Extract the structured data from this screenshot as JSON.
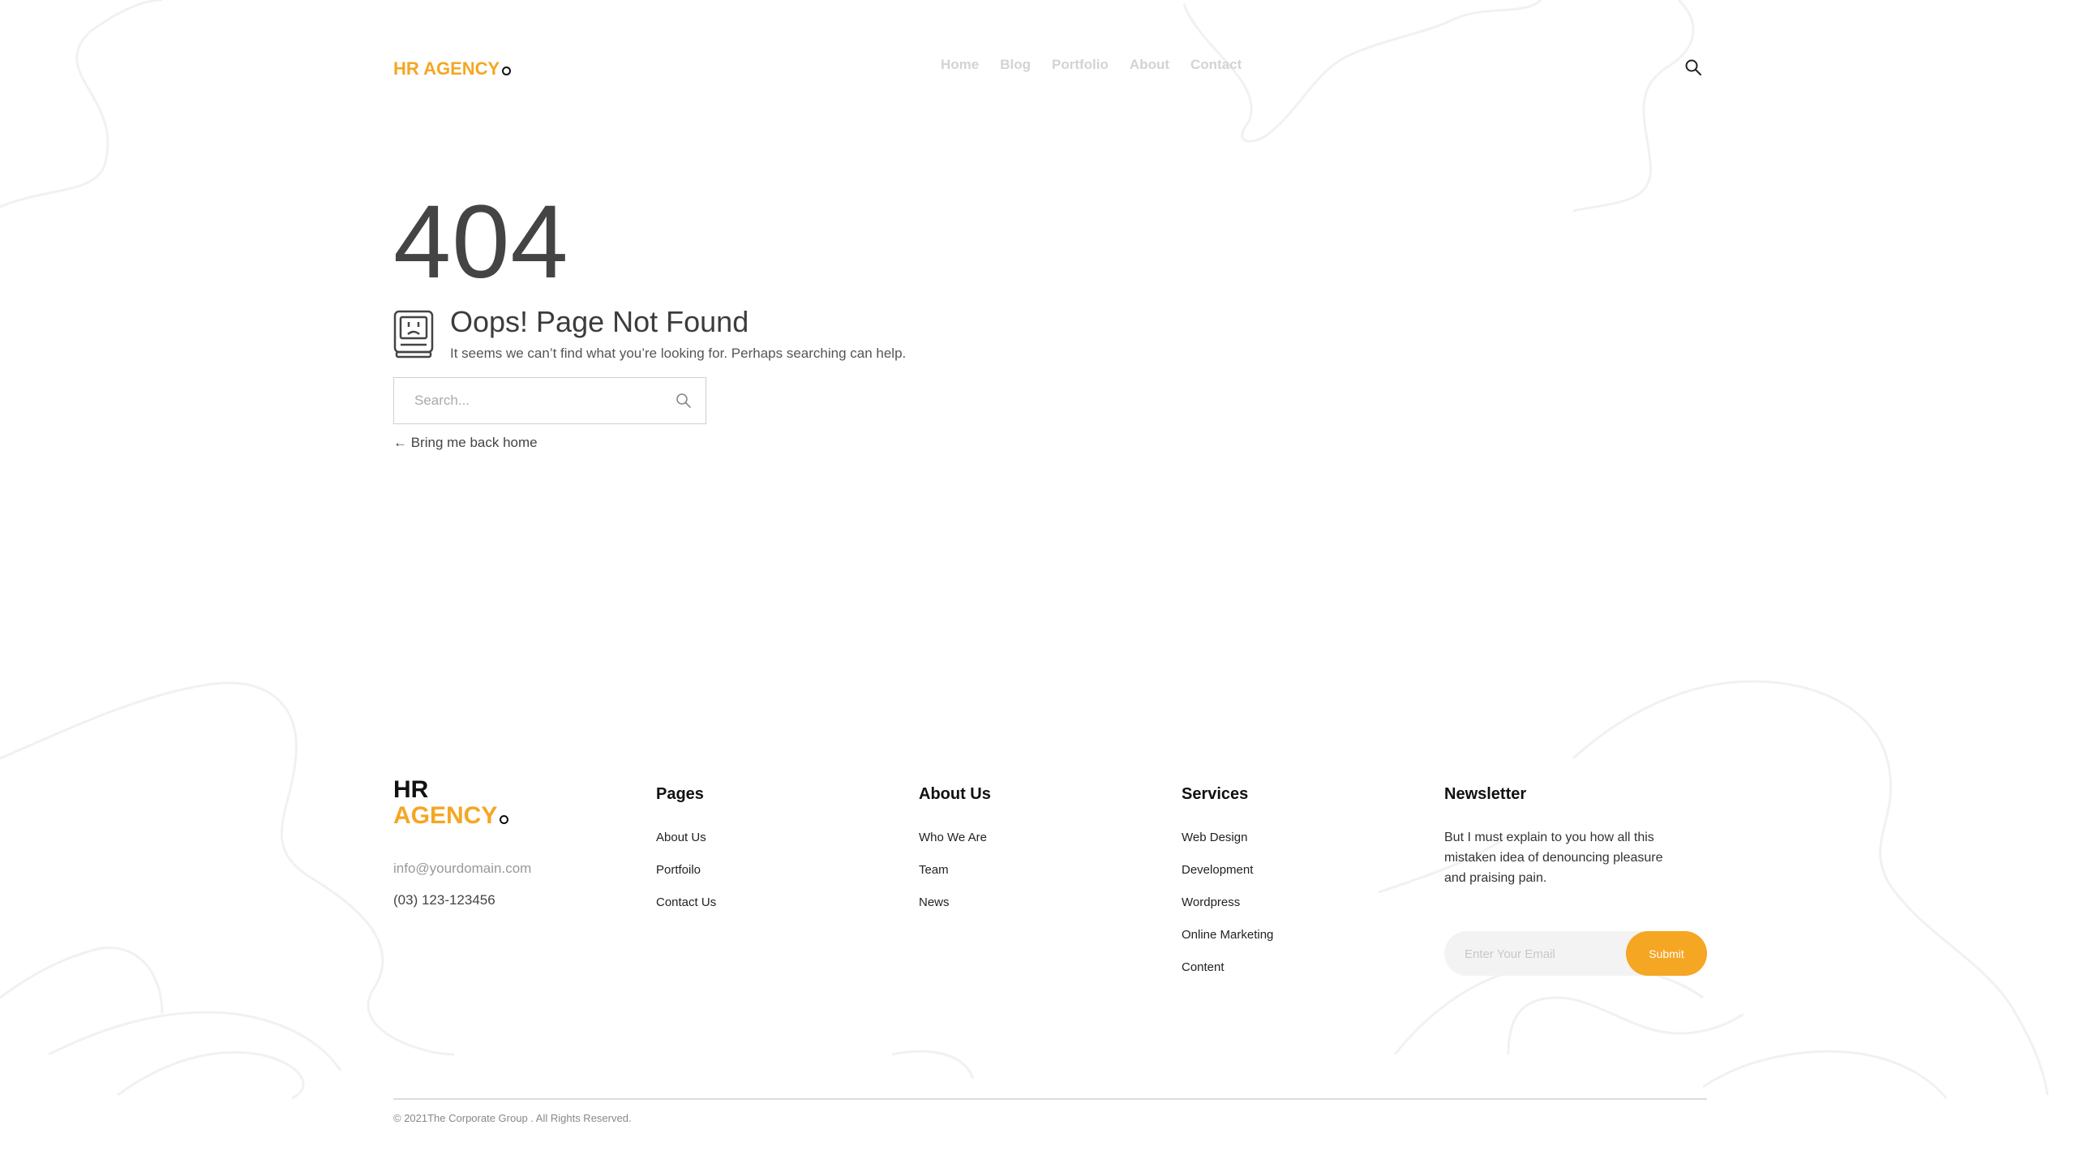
{
  "header": {
    "logo": "HR AGENCY",
    "nav": [
      "Home",
      "Blog",
      "Portfolio",
      "About",
      "Contact"
    ]
  },
  "error": {
    "code": "404",
    "title": "Oops! Page Not Found",
    "message": "It seems we can’t find what you’re looking for. Perhaps searching can help.",
    "search_placeholder": "Search...",
    "back_link": "← Bring me back home"
  },
  "footer": {
    "logo_line1": "HR",
    "logo_line2": "AGENCY",
    "email": "info@yourdomain.com",
    "phone": "(03) 123-123456",
    "pages": {
      "title": "Pages",
      "links": [
        "About Us",
        "Portfoilo",
        "Contact Us"
      ]
    },
    "about": {
      "title": "About Us",
      "links": [
        "Who We Are",
        "Team",
        "News"
      ]
    },
    "services": {
      "title": "Services",
      "links": [
        "Web Design",
        "Development",
        "Wordpress",
        "Online Marketing",
        "Content"
      ]
    },
    "newsletter": {
      "title": "Newsletter",
      "text": "But I must explain to you how all this mistaken idea of denouncing pleasure and praising pain.",
      "placeholder": "Enter Your Email",
      "button": "Submit"
    },
    "copyright": "© 2021The Corporate Group . All Rights Reserved."
  },
  "colors": {
    "accent": "#f5a623",
    "text": "#444444",
    "nav": "#d3d3d3"
  },
  "icons": {
    "header_search": "search-icon",
    "error": "sad-computer-icon",
    "search_box": "search-icon"
  }
}
